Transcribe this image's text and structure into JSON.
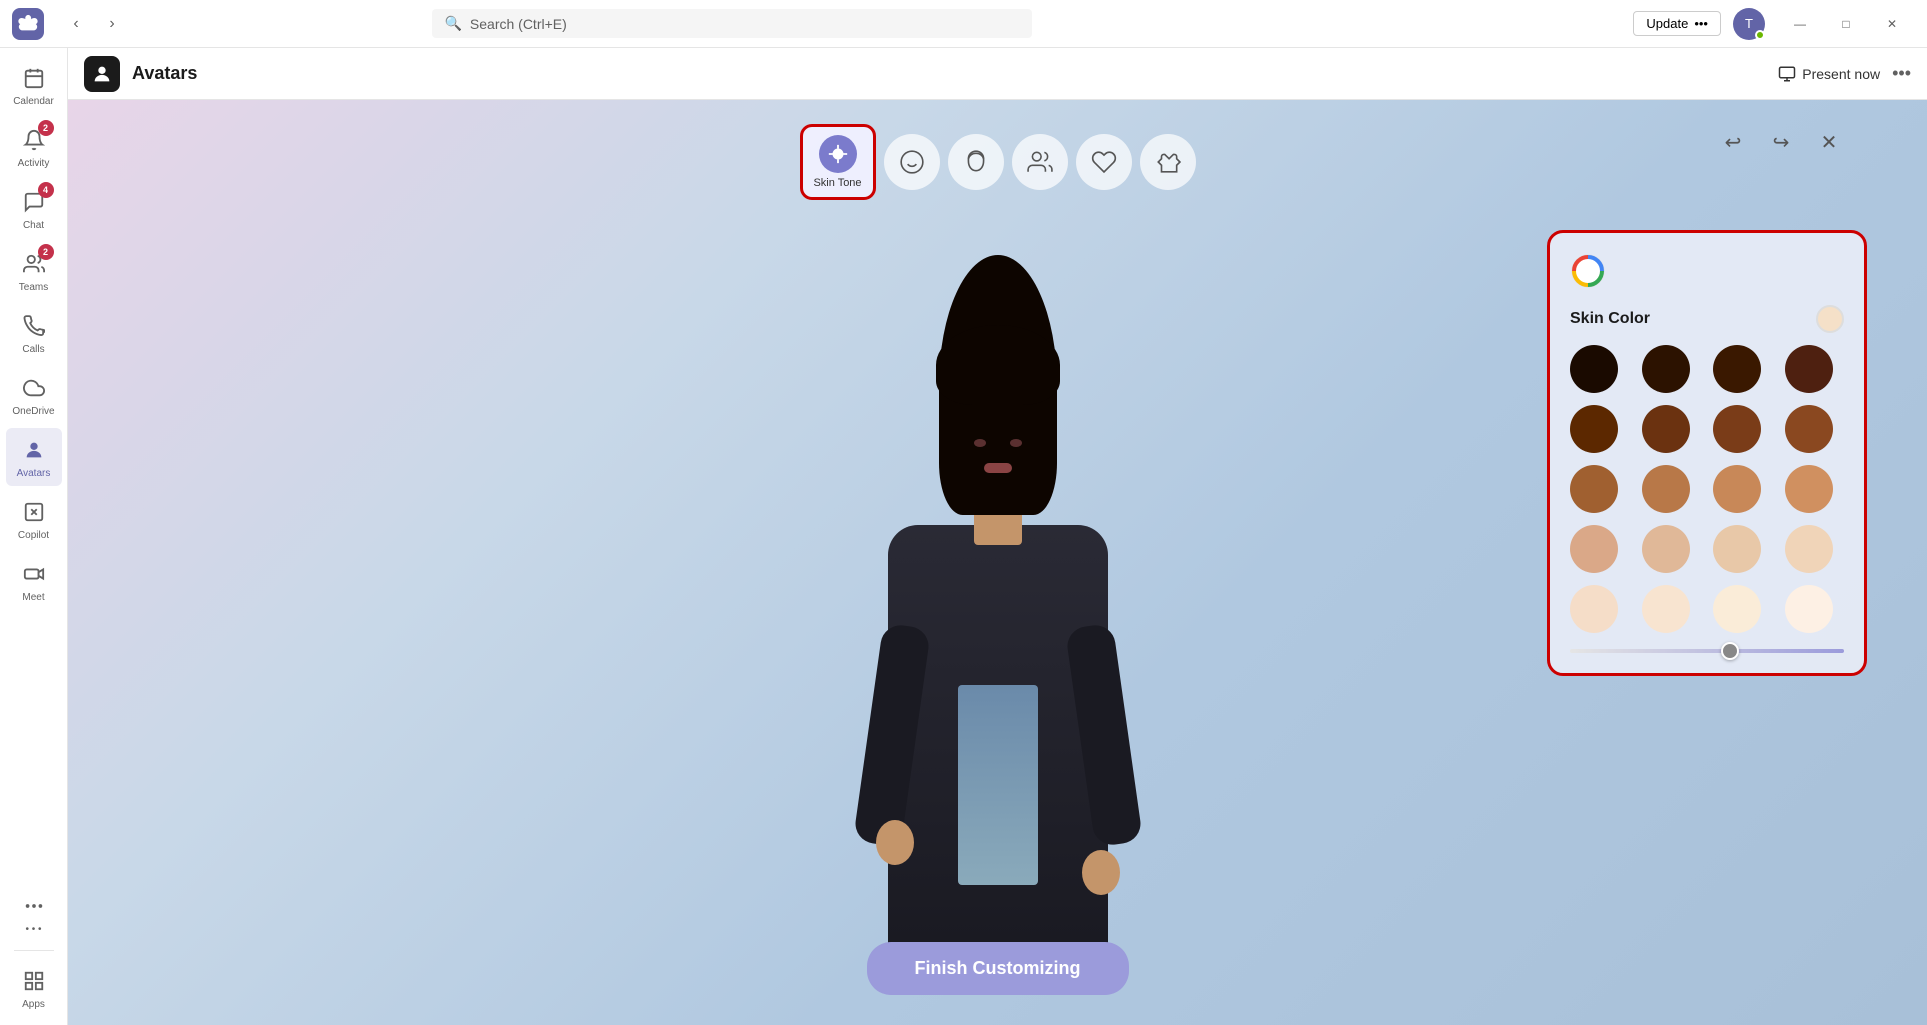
{
  "titlebar": {
    "search_placeholder": "Search (Ctrl+E)",
    "update_label": "Update",
    "update_more": "•••",
    "minimize": "—",
    "maximize": "□",
    "close": "✕"
  },
  "sidebar": {
    "items": [
      {
        "id": "calendar",
        "label": "Calendar",
        "badge": null,
        "active": false
      },
      {
        "id": "activity",
        "label": "Activity",
        "badge": "2",
        "active": false
      },
      {
        "id": "chat",
        "label": "Chat",
        "badge": "4",
        "active": false
      },
      {
        "id": "teams",
        "label": "Teams",
        "badge": "2",
        "active": false
      },
      {
        "id": "calls",
        "label": "Calls",
        "badge": null,
        "active": false
      },
      {
        "id": "onedrive",
        "label": "OneDrive",
        "badge": null,
        "active": false
      },
      {
        "id": "avatars",
        "label": "Avatars",
        "badge": null,
        "active": true
      },
      {
        "id": "copilot",
        "label": "Copilot",
        "badge": null,
        "active": false
      },
      {
        "id": "meet",
        "label": "Meet",
        "badge": null,
        "active": false
      },
      {
        "id": "more",
        "label": "•••",
        "badge": null,
        "active": false
      },
      {
        "id": "apps",
        "label": "Apps",
        "badge": null,
        "active": false
      }
    ]
  },
  "app_header": {
    "title": "Avatars",
    "present_now": "Present now",
    "more": "•••"
  },
  "toolbar": {
    "selected_tab": "Skin Tone",
    "tabs": [
      {
        "id": "skin-tone",
        "label": "Skin Tone",
        "selected": true
      },
      {
        "id": "face",
        "label": "",
        "selected": false
      },
      {
        "id": "hair",
        "label": "",
        "selected": false
      },
      {
        "id": "body",
        "label": "",
        "selected": false
      },
      {
        "id": "accessories",
        "label": "",
        "selected": false
      },
      {
        "id": "outfit",
        "label": "",
        "selected": false
      }
    ],
    "undo": "↩",
    "redo": "↪",
    "close": "✕"
  },
  "skin_panel": {
    "title": "Skin Color",
    "colors": [
      "#1a0a00",
      "#2a1200",
      "#3a1800",
      "#4a1c08",
      "#5c2800",
      "#6b3210",
      "#7a3c18",
      "#8a4820",
      "#a06030",
      "#b87848",
      "#c88858",
      "#d09060",
      "#daa888",
      "#e0b898",
      "#e8c8a8",
      "#f0d4b8",
      "#f5ddc8",
      "#f8e4d0",
      "#faecd8",
      "#fdf0e4"
    ],
    "selected_color": "#f5ddc8",
    "slider_value": 55
  },
  "finish_button": {
    "label": "Finish Customizing"
  }
}
